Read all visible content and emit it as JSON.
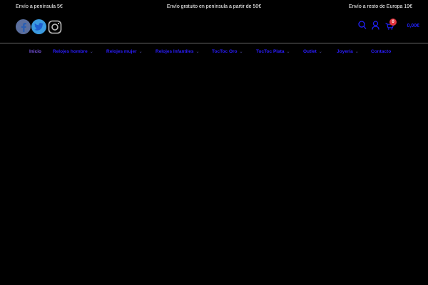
{
  "topbar": {
    "left": "Envío a península 5€",
    "center": "Envío gratuito en península a partir de 50€",
    "right": "Envío a resto de Europa 19€"
  },
  "cart": {
    "count": "0",
    "total": "0,00€"
  },
  "nav": {
    "items": [
      {
        "label": "Inicio",
        "active": true
      },
      {
        "label": "Relojes hombre",
        "active": false
      },
      {
        "label": "Relojes mujer",
        "active": false
      },
      {
        "label": "Relojes Infantiles",
        "active": false
      },
      {
        "label": "TocToc Oro",
        "active": false
      },
      {
        "label": "TocToc Plata",
        "active": false
      },
      {
        "label": "Outlet",
        "active": false
      },
      {
        "label": "Joyería",
        "active": false
      },
      {
        "label": "Contacto",
        "active": false
      }
    ]
  },
  "colors": {
    "background": "#000000",
    "nav_link": "#2b1dff",
    "nav_active": "#7a55e6",
    "badge": "#e2333d"
  },
  "icons": [
    "facebook-icon",
    "twitter-icon",
    "instagram-icon",
    "search-icon",
    "user-icon",
    "cart-icon"
  ]
}
